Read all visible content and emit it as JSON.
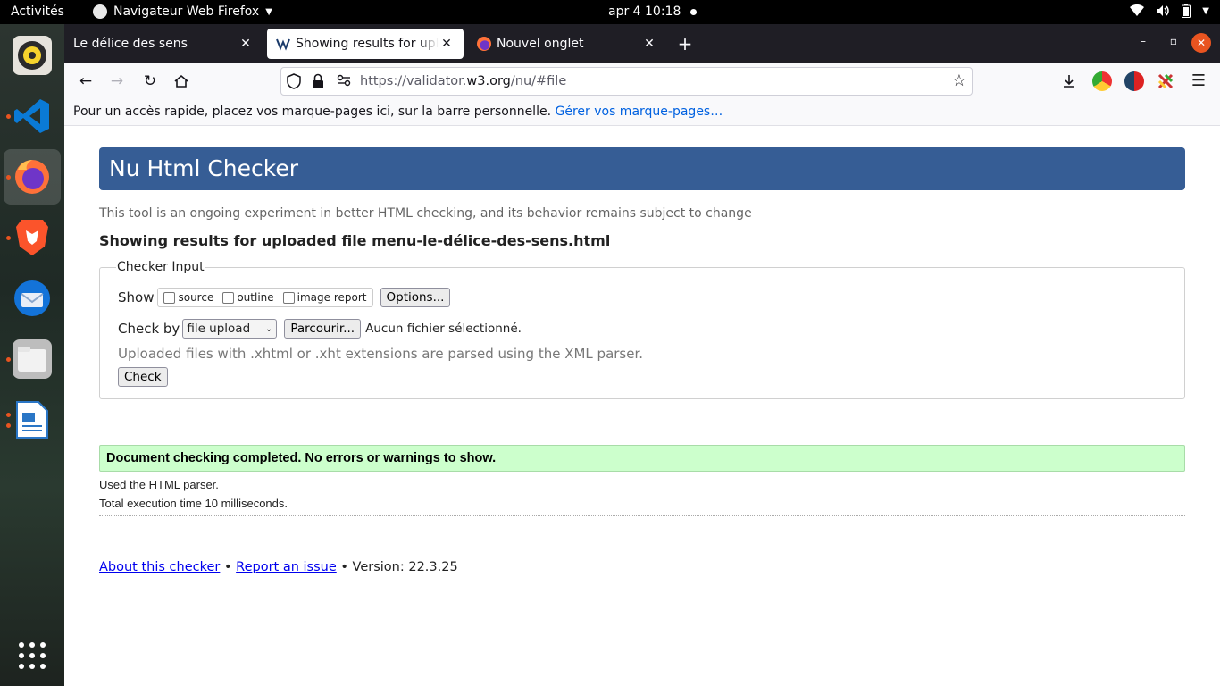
{
  "system_bar": {
    "activities": "Activités",
    "app_name": "Navigateur Web Firefox",
    "clock": "apr 4  10:18"
  },
  "dock": {
    "items": [
      {
        "name": "Rhythmbox",
        "color": "#f6d32d"
      },
      {
        "name": "Visual Studio Code",
        "color": "#0078d4"
      },
      {
        "name": "Firefox",
        "color": "#ff7139"
      },
      {
        "name": "Brave",
        "color": "#fb542b"
      },
      {
        "name": "Thunderbird",
        "color": "#1373d9"
      },
      {
        "name": "Files",
        "color": "#9d9d9d"
      },
      {
        "name": "LibreOffice Writer",
        "color": "#2a76c6"
      }
    ],
    "show_apps_icon": "grid-icon"
  },
  "tabs": [
    {
      "title": "Le délice des sens",
      "selected": false
    },
    {
      "title": "Showing results for uploaded file menu-le-délice-des-sens.html",
      "selected": true
    },
    {
      "title": "Nouvel onglet",
      "selected": false
    }
  ],
  "window_controls": {
    "minimize": "–",
    "maximize": "▫",
    "close": "✕"
  },
  "navbar": {
    "url_prefix": "https://validator.",
    "url_domain": "w3.org",
    "url_path": "/nu/#file"
  },
  "bookmarks_bar": {
    "text": "Pour un accès rapide, placez vos marque-pages ici, sur la barre personnelle.",
    "manage_link": "Gérer vos marque-pages…"
  },
  "page": {
    "title": "Nu Html Checker",
    "subtitle": "This tool is an ongoing experiment in better HTML checking, and its behavior remains subject to change",
    "results_heading": "Showing results for uploaded file menu-le-délice-des-sens.html",
    "checker": {
      "legend": "Checker Input",
      "show_label": "Show",
      "checkboxes": [
        "source",
        "outline",
        "image report"
      ],
      "options_button": "Options...",
      "check_by_label": "Check by",
      "check_by_value": "file upload",
      "browse_button": "Parcourir...",
      "no_file": "Aucun fichier sélectionné.",
      "xml_note": "Uploaded files with .xhtml or .xht extensions are parsed using the XML parser.",
      "check_button": "Check"
    },
    "success_message": "Document checking completed. No errors or warnings to show.",
    "parser_info": "Used the HTML parser.",
    "execution_time": "Total execution time 10 milliseconds.",
    "footer": {
      "about_link": "About this checker",
      "separator": "•",
      "report_link": "Report an issue",
      "version": "Version: 22.3.25"
    }
  },
  "colors": {
    "banner": "#365d95",
    "success_bg": "#ccffcc",
    "link": "#0000ee",
    "accent": "#e95420"
  }
}
